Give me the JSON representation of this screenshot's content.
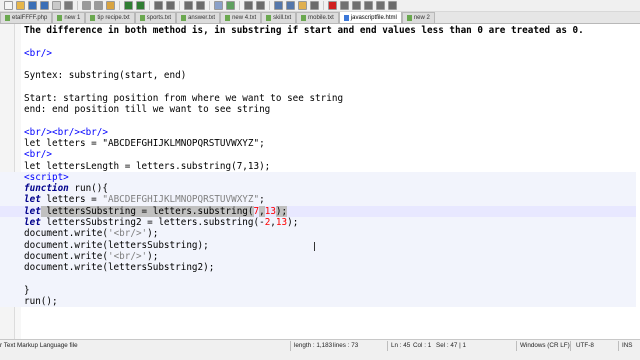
{
  "toolbar": {
    "buttons": [
      {
        "icon": "new-file-icon",
        "color": "#f5f5f5"
      },
      {
        "icon": "open-file-icon",
        "color": "#e7b64a"
      },
      {
        "icon": "save-icon",
        "color": "#3b6fb6"
      },
      {
        "icon": "save-all-icon",
        "color": "#3b6fb6"
      },
      {
        "icon": "close-icon",
        "color": "#c9c9c9"
      },
      {
        "icon": "print-icon",
        "color": "#7a7a7a"
      },
      {
        "icon": "cut-icon",
        "color": "#9a9a9a"
      },
      {
        "icon": "copy-icon",
        "color": "#9a9a9a"
      },
      {
        "icon": "paste-icon",
        "color": "#d9a441"
      },
      {
        "icon": "undo-icon",
        "color": "#2f7d32"
      },
      {
        "icon": "redo-icon",
        "color": "#2f7d32"
      },
      {
        "icon": "find-icon",
        "color": "#6b6b6b"
      },
      {
        "icon": "replace-icon",
        "color": "#6b6b6b"
      },
      {
        "icon": "zoom-in-icon",
        "color": "#6b6b6b"
      },
      {
        "icon": "zoom-out-icon",
        "color": "#6b6b6b"
      },
      {
        "icon": "sync-scroll-icon",
        "color": "#8aa0c8"
      },
      {
        "icon": "word-wrap-icon",
        "color": "#5fa05f"
      },
      {
        "icon": "show-all-chars-icon",
        "color": "#6b6b6b"
      },
      {
        "icon": "indent-guide-icon",
        "color": "#6b6b6b"
      },
      {
        "icon": "doc-map-icon",
        "color": "#5577aa"
      },
      {
        "icon": "function-list-icon",
        "color": "#5577aa"
      },
      {
        "icon": "folder-workspace-icon",
        "color": "#e0b050"
      },
      {
        "icon": "monitoring-icon",
        "color": "#6b6b6b"
      },
      {
        "icon": "record-macro-icon",
        "color": "#d02020"
      },
      {
        "icon": "stop-macro-icon",
        "color": "#707070"
      },
      {
        "icon": "play-macro-icon",
        "color": "#707070"
      },
      {
        "icon": "run-macro-multiple-icon",
        "color": "#707070"
      },
      {
        "icon": "save-macro-icon",
        "color": "#707070"
      },
      {
        "icon": "spellcheck-icon",
        "color": "#6b6b6b"
      }
    ]
  },
  "tabs": [
    {
      "label": "etalFFFF.php",
      "active": false
    },
    {
      "label": "new 1",
      "active": false
    },
    {
      "label": "tip recipe.txt",
      "active": false
    },
    {
      "label": "sports.txt",
      "active": false
    },
    {
      "label": "answer.txt",
      "active": false
    },
    {
      "label": "new 4.txt",
      "active": false
    },
    {
      "label": "skill.txt",
      "active": false
    },
    {
      "label": "mobile.txt",
      "active": false
    },
    {
      "label": "javascriptfile.html",
      "active": true
    },
    {
      "label": "new 2",
      "active": false
    }
  ],
  "code_lines": [
    [
      {
        "t": "The difference in both method is, in substring if start and end values less than 0 are treated as 0.",
        "c": "b"
      }
    ],
    [],
    [
      {
        "t": "<br/>",
        "c": "tag"
      }
    ],
    [],
    [
      {
        "t": "Syntex: substring(start, end)"
      }
    ],
    [],
    [
      {
        "t": "Start: starting position from where we want to see string"
      }
    ],
    [
      {
        "t": "end: end position till we want to see string"
      }
    ],
    [],
    [
      {
        "t": "<br/><br/><br/>",
        "c": "tag"
      }
    ],
    [
      {
        "t": "let letters = \"ABCDEFGHIJKLMNOPQRSTUVWXYZ\";"
      }
    ],
    [
      {
        "t": "<br/>",
        "c": "tag"
      }
    ],
    [
      {
        "t": "let lettersLength = letters.substring(7,13);"
      }
    ],
    [
      {
        "t": "<script>",
        "c": "tag"
      }
    ],
    [
      {
        "t": "function",
        "c": "kw"
      },
      {
        "t": " run(){"
      }
    ],
    [
      {
        "t": "let",
        "c": "kw"
      },
      {
        "t": " letters = "
      },
      {
        "t": "\"ABCDEFGHIJKLMNOPQRSTUVWXYZ\"",
        "c": "str"
      },
      {
        "t": ";"
      }
    ],
    [
      {
        "t": "let",
        "c": "kw"
      },
      {
        "t": " lettersSubstring = letters.substring(",
        "c": "sel"
      },
      {
        "t": "7",
        "c": "num"
      },
      {
        "t": ",",
        "c": "sel"
      },
      {
        "t": "13",
        "c": "num"
      },
      {
        "t": ");",
        "c": "sel"
      }
    ],
    [
      {
        "t": "let",
        "c": "kw"
      },
      {
        "t": " lettersSubstring2 = letters.substring(-"
      },
      {
        "t": "2",
        "c": "num"
      },
      {
        "t": ","
      },
      {
        "t": "13",
        "c": "num"
      },
      {
        "t": ");"
      }
    ],
    [
      {
        "t": "document.write("
      },
      {
        "t": "'<br/>'",
        "c": "str"
      },
      {
        "t": ");"
      }
    ],
    [
      {
        "t": "document.write(lettersSubstring);"
      }
    ],
    [
      {
        "t": "document.write("
      },
      {
        "t": "'<br/>'",
        "c": "str"
      },
      {
        "t": ");"
      }
    ],
    [
      {
        "t": "document.write(lettersSubstring2);"
      }
    ],
    [],
    [
      {
        "t": "}"
      }
    ],
    [
      {
        "t": "run();"
      }
    ],
    []
  ],
  "status": {
    "file_type": "r Text Markup Language file",
    "length": "length : 1,183",
    "lines": "lines : 73",
    "ln": "Ln : 45",
    "col": "Col : 1",
    "sel": "Sel : 47 | 1",
    "eol": "Windows (CR LF)",
    "encoding": "UTF-8",
    "mode": "INS"
  }
}
